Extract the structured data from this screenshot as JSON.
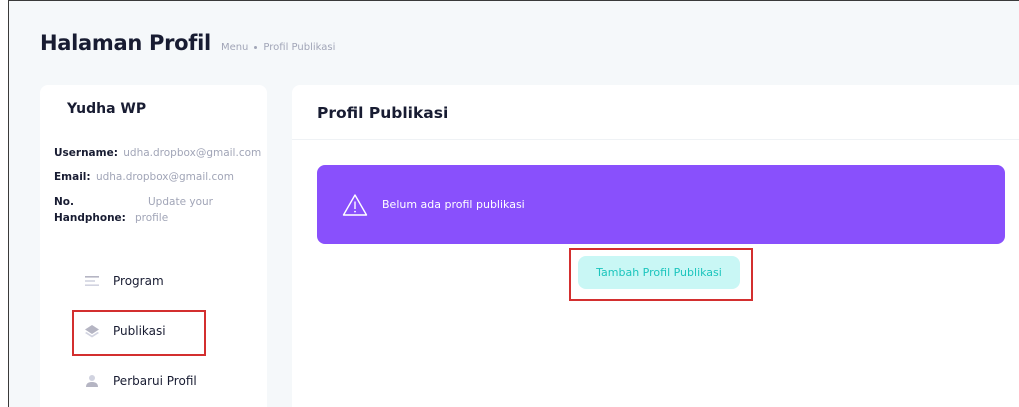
{
  "header": {
    "title": "Halaman Profil",
    "breadcrumb": [
      "Menu",
      "Profil Publikasi"
    ]
  },
  "sidebar": {
    "user_name": "Yudha WP",
    "info": {
      "username_label": "Username:",
      "username_value": "udha.dropbox@gmail.com",
      "email_label": "Email:",
      "email_value": "udha.dropbox@gmail.com",
      "phone_label_line1": "No.",
      "phone_label_line2": "Handphone:",
      "phone_value_line1": "Update your",
      "phone_value_line2": "profile"
    },
    "nav": [
      {
        "label": "Program",
        "icon": "list-icon"
      },
      {
        "label": "Publikasi",
        "icon": "layers-icon"
      },
      {
        "label": "Perbarui Profil",
        "icon": "user-icon"
      }
    ]
  },
  "main": {
    "title": "Profil Publikasi",
    "alert_text": "Belum ada profil publikasi",
    "add_button_label": "Tambah Profil Publikasi"
  },
  "colors": {
    "alert_bg": "#8950fc",
    "button_bg": "#c9f7f5",
    "button_text": "#1bc5bd",
    "highlight": "#d32f2f"
  }
}
